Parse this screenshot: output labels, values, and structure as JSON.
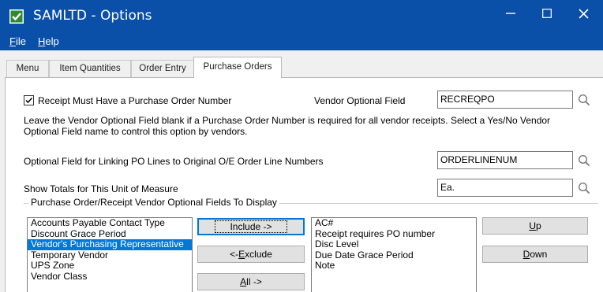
{
  "window": {
    "title": "SAMLTD - Options",
    "menu": [
      {
        "label": "File",
        "accel": "F",
        "rest": "ile"
      },
      {
        "label": "Help",
        "accel": "H",
        "rest": "elp"
      }
    ]
  },
  "tabs": [
    "Menu",
    "Item Quantities",
    "Order Entry",
    "Purchase Orders"
  ],
  "active_tab": "Purchase Orders",
  "receipt_po": {
    "checkbox_label": "Receipt Must Have a Purchase Order Number",
    "checked": true,
    "vendor_field_label": "Vendor Optional Field",
    "vendor_field_value": "RECREQPO",
    "help_line1": "Leave the Vendor Optional Field blank if a Purchase Order Number is required for all vendor receipts. Select a Yes/No Vendor",
    "help_line2": "Optional Field name to control this option by vendors."
  },
  "linking": {
    "label": "Optional Field for Linking PO Lines to Original O/E Order Line Numbers",
    "value": "ORDERLINENUM"
  },
  "totals": {
    "label": "Show Totals for This Unit of Measure",
    "value": "Ea."
  },
  "group": {
    "title": "Purchase Order/Receipt Vendor Optional Fields To Display",
    "available": [
      "Accounts Payable Contact Type",
      "Discount Grace Period",
      "Vendor's Purchasing Representative",
      "Temporary Vendor",
      "UPS Zone",
      "Vendor Class"
    ],
    "selected_available": "Vendor's Purchasing Representative",
    "displayed": [
      "AC#",
      "Receipt requires PO number",
      "Disc Level",
      "Due Date Grace Period",
      "Note"
    ],
    "buttons": {
      "include_label": "Include ->",
      "exclude_accel": "E",
      "exclude_pre": "<- ",
      "exclude_rest": "xclude",
      "all_accel": "A",
      "all_rest": "ll ->",
      "up_accel": "U",
      "up_rest": "p",
      "down_accel": "D",
      "down_rest": "own"
    }
  },
  "colors": {
    "titlebar": "#0a4fa8",
    "selection": "#0078d7"
  },
  "icons": [
    "sage-logo-icon",
    "minimize-icon",
    "maximize-icon",
    "close-icon",
    "check-icon",
    "magnifier-icon"
  ]
}
